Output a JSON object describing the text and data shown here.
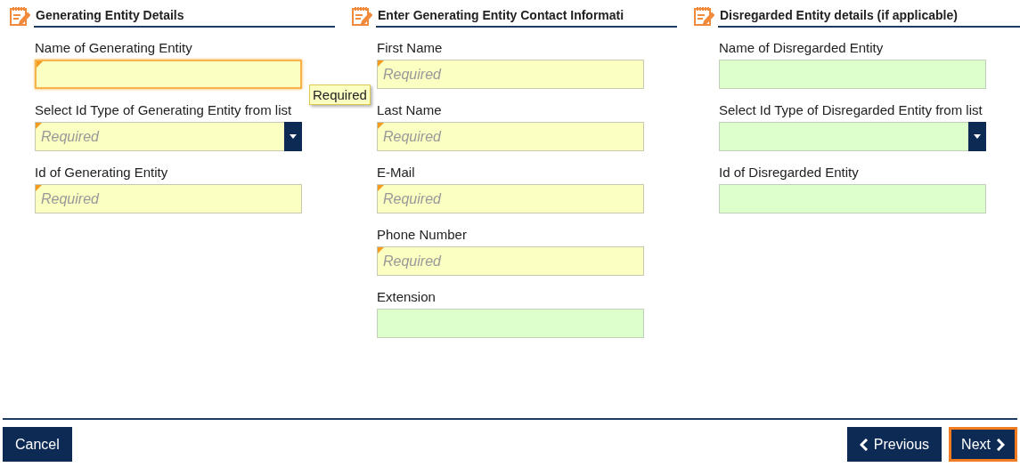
{
  "sections": [
    {
      "title": "Generating Entity Details",
      "fields": [
        {
          "label": "Name of Generating Entity",
          "kind": "text",
          "required": true,
          "focused": true,
          "tooltip": "Required"
        },
        {
          "label": "Select Id Type of Generating Entity from list",
          "kind": "select",
          "required": true,
          "focused": false,
          "placeholder": "Required"
        },
        {
          "label": "Id of Generating Entity",
          "kind": "text",
          "required": true,
          "focused": false,
          "placeholder": "Required"
        }
      ]
    },
    {
      "title": "Enter Generating Entity Contact Informati",
      "fields": [
        {
          "label": "First Name",
          "kind": "text",
          "required": true,
          "focused": false,
          "placeholder": "Required"
        },
        {
          "label": "Last Name",
          "kind": "text",
          "required": true,
          "focused": false,
          "placeholder": "Required"
        },
        {
          "label": "E-Mail",
          "kind": "text",
          "required": true,
          "focused": false,
          "placeholder": "Required"
        },
        {
          "label": "Phone Number",
          "kind": "text",
          "required": true,
          "focused": false,
          "placeholder": "Required"
        },
        {
          "label": "Extension",
          "kind": "text",
          "required": false,
          "focused": false
        }
      ]
    },
    {
      "title": "Disregarded Entity details (if applicable)",
      "fields": [
        {
          "label": "Name of Disregarded Entity",
          "kind": "text",
          "required": false,
          "focused": false
        },
        {
          "label": "Select Id Type of Disregarded Entity from list",
          "kind": "select",
          "required": false,
          "focused": false
        },
        {
          "label": "Id of Disregarded Entity",
          "kind": "text",
          "required": false,
          "focused": false
        }
      ]
    }
  ],
  "footer": {
    "cancel": {
      "label": "Cancel",
      "focused": false
    },
    "previous": {
      "label": "Previous",
      "focused": false
    },
    "next": {
      "label": "Next",
      "focused": true
    }
  }
}
